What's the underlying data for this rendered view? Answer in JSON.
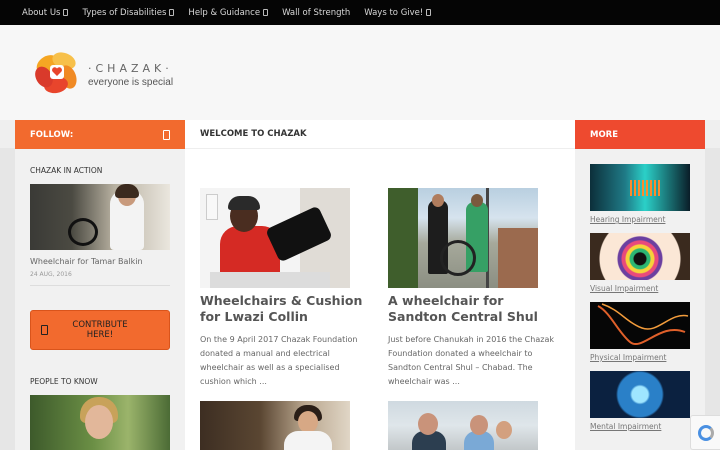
{
  "nav": {
    "items": [
      {
        "label": "About Us",
        "has_dropdown": true
      },
      {
        "label": "Types of Disabilities",
        "has_dropdown": true
      },
      {
        "label": "Help & Guidance",
        "has_dropdown": true
      },
      {
        "label": "Wall of Strength",
        "has_dropdown": false
      },
      {
        "label": "Ways to Give!",
        "has_dropdown": true
      }
    ]
  },
  "brand": {
    "name": "·CHAZAK·",
    "tagline": "everyone is special"
  },
  "left": {
    "follow_label": "FOLLOW:",
    "in_action_heading": "CHAZAK IN ACTION",
    "in_action_post": {
      "title": "Wheelchair for Tamar Balkin",
      "date": "24 AUG, 2016"
    },
    "contribute_label": "CONTRIBUTE HERE!",
    "people_heading": "PEOPLE TO KNOW"
  },
  "main": {
    "heading": "WELCOME TO CHAZAK",
    "posts": [
      {
        "title": "Wheelchairs & Cushion for Lwazi Collin",
        "excerpt": "On the 9 April 2017 Chazak Foundation donated a manual and electrical wheelchair as well as a specialised cushion which ..."
      },
      {
        "title": "A wheelchair for Sandton Central Shul",
        "excerpt": "Just before Chanukah in 2016 the Chazak Foundation donated a wheelchair to Sandton Central Shul – Chabad. The wheelchair was ..."
      }
    ]
  },
  "right": {
    "more_label": "MORE",
    "items": [
      {
        "label": "Hearing Impairment"
      },
      {
        "label": "Visual Impairment"
      },
      {
        "label": "Physical Impairment"
      },
      {
        "label": "Mental Impairment"
      }
    ]
  },
  "colors": {
    "accent_orange": "#f26a2e",
    "accent_red": "#ee4a2f",
    "topnav_bg": "#050505"
  }
}
